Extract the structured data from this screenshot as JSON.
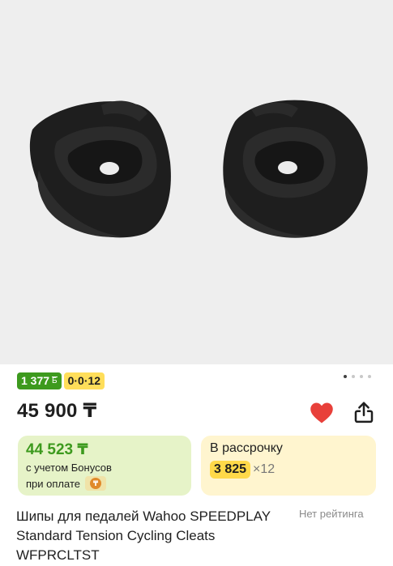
{
  "product": {
    "image_alt": "Wahoo SPEEDPLAY cleats",
    "gallery": {
      "slide_count": 4,
      "active_index": 0
    },
    "badges": {
      "bonus": "1 377",
      "bonus_icon": "Б",
      "installment": "0·0·12"
    },
    "price": "45 900 ₸",
    "favorite": {
      "icon": "heart-icon",
      "active": true,
      "color": "#e8403a"
    },
    "share": {
      "icon": "share-icon"
    },
    "bonus_card": {
      "amount": "44 523 ₸",
      "line1": "с учетом Бонусов",
      "line2": "при оплате"
    },
    "installment_card": {
      "title": "В рассрочку",
      "monthly": "3 825",
      "multiplier": "×12"
    },
    "name": "Шипы для педалей Wahoo SPEEDPLAY Standard Tension Cycling Cleats WFPRCLTST",
    "rating_text": "Нет рейтинга"
  },
  "colors": {
    "bonus_green": "#3d9a1e",
    "installment_yellow": "#ffde5a",
    "green_card_bg": "#e6f3c8",
    "yellow_card_bg": "#fff5cf"
  }
}
